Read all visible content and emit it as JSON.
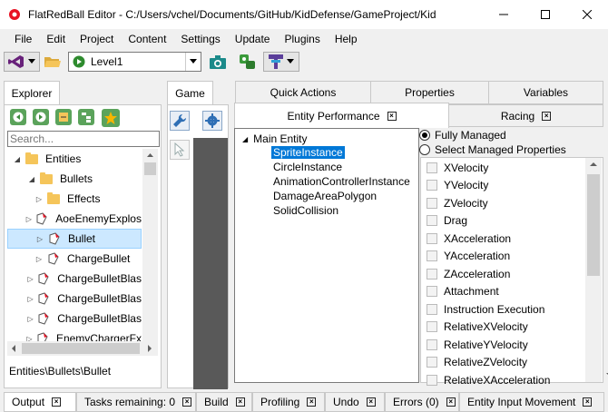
{
  "window": {
    "title": "FlatRedBall Editor - C:/Users/vchel/Documents/GitHub/KidDefense/GameProject/KidDefense...",
    "controls": [
      "minimize",
      "maximize",
      "close"
    ]
  },
  "menu": [
    "File",
    "Edit",
    "Project",
    "Content",
    "Settings",
    "Update",
    "Plugins",
    "Help"
  ],
  "toolbar": {
    "level_combo": "Level1"
  },
  "explorer": {
    "tab_label": "Explorer",
    "search_placeholder": "Search...",
    "tree": [
      {
        "label": "Entities",
        "type": "folder",
        "expanded": true,
        "indent": 0
      },
      {
        "label": "Bullets",
        "type": "folder",
        "expanded": true,
        "indent": 1
      },
      {
        "label": "Effects",
        "type": "folder",
        "expanded": false,
        "indent": 2
      },
      {
        "label": "AoeEnemyExplos",
        "type": "entity",
        "expanded": false,
        "indent": 2
      },
      {
        "label": "Bullet",
        "type": "entity",
        "expanded": false,
        "indent": 2,
        "selected": true
      },
      {
        "label": "ChargeBullet",
        "type": "entity",
        "expanded": false,
        "indent": 2
      },
      {
        "label": "ChargeBulletBlas",
        "type": "entity",
        "expanded": false,
        "indent": 2
      },
      {
        "label": "ChargeBulletBlas",
        "type": "entity",
        "expanded": false,
        "indent": 2
      },
      {
        "label": "ChargeBulletBlas",
        "type": "entity",
        "expanded": false,
        "indent": 2
      },
      {
        "label": "EnemyChargerFx",
        "type": "entity",
        "expanded": false,
        "indent": 2
      }
    ],
    "path": "Entities\\Bullets\\Bullet"
  },
  "game_tab": {
    "label": "Game"
  },
  "right_tabs_row1": [
    "Quick Actions",
    "Properties",
    "Variables"
  ],
  "right_tabs_row2": [
    {
      "label": "Entity Performance",
      "closable": true,
      "active": true
    },
    {
      "label": "Racing",
      "closable": true,
      "active": false
    }
  ],
  "entity_tree": {
    "root": "Main Entity",
    "children": [
      "SpriteInstance",
      "CircleInstance",
      "AnimationControllerInstance",
      "DamageAreaPolygon",
      "SolidCollision"
    ],
    "selected": "SpriteInstance"
  },
  "managed": {
    "options": [
      "Fully Managed",
      "Select Managed Properties"
    ],
    "selected": "Fully Managed",
    "properties": [
      "XVelocity",
      "YVelocity",
      "ZVelocity",
      "Drag",
      "XAcceleration",
      "YAcceleration",
      "ZAcceleration",
      "Attachment",
      "Instruction Execution",
      "RelativeXVelocity",
      "RelativeYVelocity",
      "RelativeZVelocity",
      "RelativeXAcceleration"
    ]
  },
  "bottom_tabs": [
    {
      "label": "Output",
      "active": true
    },
    {
      "label": "Tasks remaining: 0",
      "active": false
    },
    {
      "label": "Build",
      "active": false
    },
    {
      "label": "Profiling",
      "active": false
    },
    {
      "label": "Undo",
      "active": false
    },
    {
      "label": "Errors (0)",
      "active": false
    },
    {
      "label": "Entity Input Movement",
      "active": false
    }
  ],
  "colors": {
    "selection": "#cce8ff",
    "entity_tree_selection": "#0078d7",
    "game_canvas": "#595959",
    "folder": "#f5c55a",
    "frb_red": "#e81123"
  }
}
